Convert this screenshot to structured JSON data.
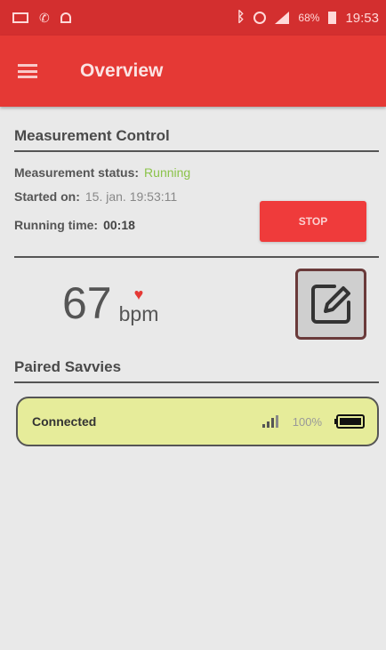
{
  "status_bar": {
    "battery_pct": "68%",
    "time": "19:53"
  },
  "app_bar": {
    "title": "Overview"
  },
  "measurement_control": {
    "section_title": "Measurement Control",
    "status_label": "Measurement status:",
    "status_value": "Running",
    "started_label": "Started on:",
    "started_value": "15. jan. 19:53:11",
    "running_label": "Running time:",
    "running_value": "00:18",
    "stop_label": "STOP"
  },
  "heart_rate": {
    "value": "67",
    "unit": "bpm"
  },
  "paired": {
    "section_title": "Paired Savvies",
    "devices": [
      {
        "status": "Connected",
        "battery": "100%"
      }
    ]
  },
  "colors": {
    "status_bar": "#d32f2f",
    "app_bar": "#e53935",
    "running": "#8bc34a",
    "stop_button": "#ef3b3b",
    "device_card": "#e6ec9a"
  }
}
